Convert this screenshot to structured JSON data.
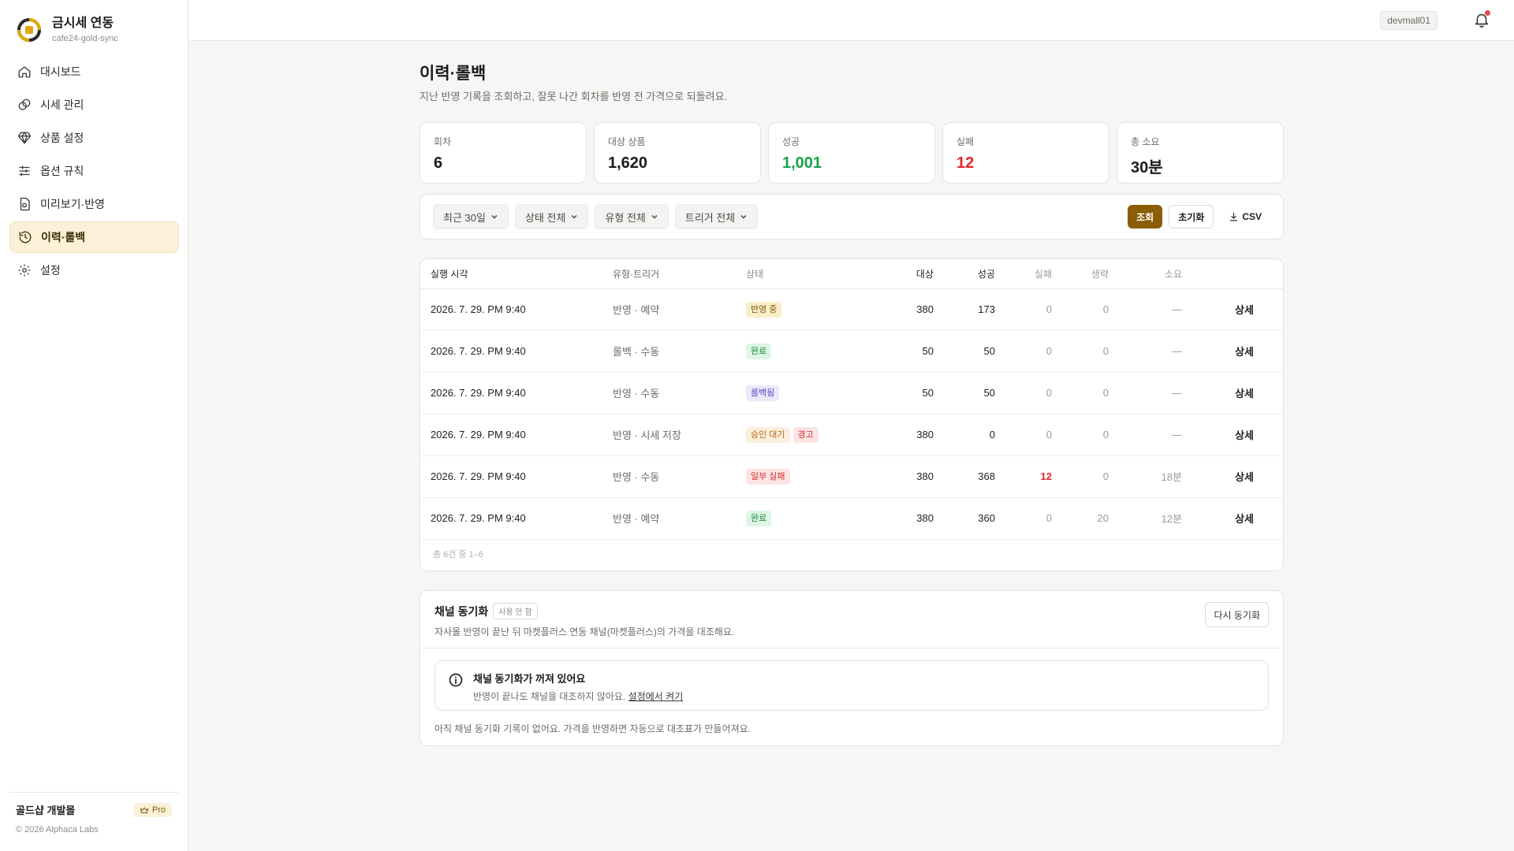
{
  "brand": {
    "title": "금시세 연동",
    "subtitle": "cafe24-gold-sync"
  },
  "nav": [
    {
      "label": "대시보드",
      "icon": "home-icon"
    },
    {
      "label": "시세 관리",
      "icon": "coins-icon"
    },
    {
      "label": "상품 설정",
      "icon": "diamond-icon"
    },
    {
      "label": "옵션 규칙",
      "icon": "sliders-icon"
    },
    {
      "label": "미리보기·반영",
      "icon": "file-preview-icon"
    },
    {
      "label": "이력·롤백",
      "icon": "history-icon",
      "active": true
    },
    {
      "label": "설정",
      "icon": "gear-icon"
    }
  ],
  "footer": {
    "org": "골드샵 개발몰",
    "plan": "Pro",
    "copyright": "© 2026 Alphaca Labs"
  },
  "topbar": {
    "user": "devmall01"
  },
  "page": {
    "title": "이력·롤백",
    "description": "지난 반영 기록을 조회하고, 잘못 나간 회차를 반영 전 가격으로 되돌려요."
  },
  "stats": [
    {
      "label": "회차",
      "value": "6",
      "tone": "default"
    },
    {
      "label": "대상 상품",
      "value": "1,620",
      "tone": "default"
    },
    {
      "label": "성공",
      "value": "1,001",
      "tone": "green"
    },
    {
      "label": "실패",
      "value": "12",
      "tone": "red"
    },
    {
      "label": "총 소요",
      "value": "30분",
      "tone": "default"
    }
  ],
  "filters": {
    "period": "최근 30일",
    "status": "상태 전체",
    "type": "유형 전체",
    "trigger": "트리거 전체",
    "search_label": "조회",
    "reset_label": "초기화",
    "csv_label": "CSV"
  },
  "table": {
    "headers": {
      "time": "실행 시각",
      "type": "유형·트리거",
      "status": "상태",
      "target": "대상",
      "success": "성공",
      "fail": "실패",
      "skip": "생략",
      "duration": "소요"
    },
    "rows": [
      {
        "time": "2026. 7. 29. PM 9:40",
        "type": "반영 · 예약",
        "badges": [
          {
            "text": "반영 중",
            "kind": "running"
          }
        ],
        "target": "380",
        "success": "173",
        "fail": "0",
        "skip": "0",
        "duration": "—",
        "action": "상세"
      },
      {
        "time": "2026. 7. 29. PM 9:40",
        "type": "롤백 · 수동",
        "badges": [
          {
            "text": "완료",
            "kind": "done"
          }
        ],
        "target": "50",
        "success": "50",
        "fail": "0",
        "skip": "0",
        "duration": "—",
        "action": "상세"
      },
      {
        "time": "2026. 7. 29. PM 9:40",
        "type": "반영 · 수동",
        "badges": [
          {
            "text": "롤백됨",
            "kind": "rolled"
          }
        ],
        "target": "50",
        "success": "50",
        "fail": "0",
        "skip": "0",
        "duration": "—",
        "action": "상세"
      },
      {
        "time": "2026. 7. 29. PM 9:40",
        "type": "반영 · 시세 저장",
        "badges": [
          {
            "text": "승인 대기",
            "kind": "pending"
          },
          {
            "text": "경고",
            "kind": "warn"
          }
        ],
        "target": "380",
        "success": "0",
        "fail": "0",
        "skip": "0",
        "duration": "—",
        "action": "상세"
      },
      {
        "time": "2026. 7. 29. PM 9:40",
        "type": "반영 · 수동",
        "badges": [
          {
            "text": "일부 실패",
            "kind": "partial"
          }
        ],
        "target": "380",
        "success": "368",
        "fail": "12",
        "fail_alert": true,
        "skip": "0",
        "duration": "18분",
        "action": "상세"
      },
      {
        "time": "2026. 7. 29. PM 9:40",
        "type": "반영 · 예약",
        "badges": [
          {
            "text": "완료",
            "kind": "done"
          }
        ],
        "target": "380",
        "success": "360",
        "fail": "0",
        "skip": "20",
        "duration": "12분",
        "action": "상세"
      }
    ],
    "footer": "총 6건 중 1–6"
  },
  "sync": {
    "title": "채널 동기화",
    "badge": "사용 안 함",
    "description": "자사몰 반영이 끝난 뒤 마켓플러스 연동 채널(마켓플러스)의 가격을 대조해요.",
    "resync_label": "다시 동기화",
    "notice_title": "채널 동기화가 꺼져 있어요",
    "notice_text": "반영이 끝나도 채널을 대조하지 않아요.",
    "notice_link": "설정에서 켜기",
    "empty": "아직 채널 동기화 기록이 없어요. 가격을 반영하면 자동으로 대조표가 만들어져요."
  }
}
